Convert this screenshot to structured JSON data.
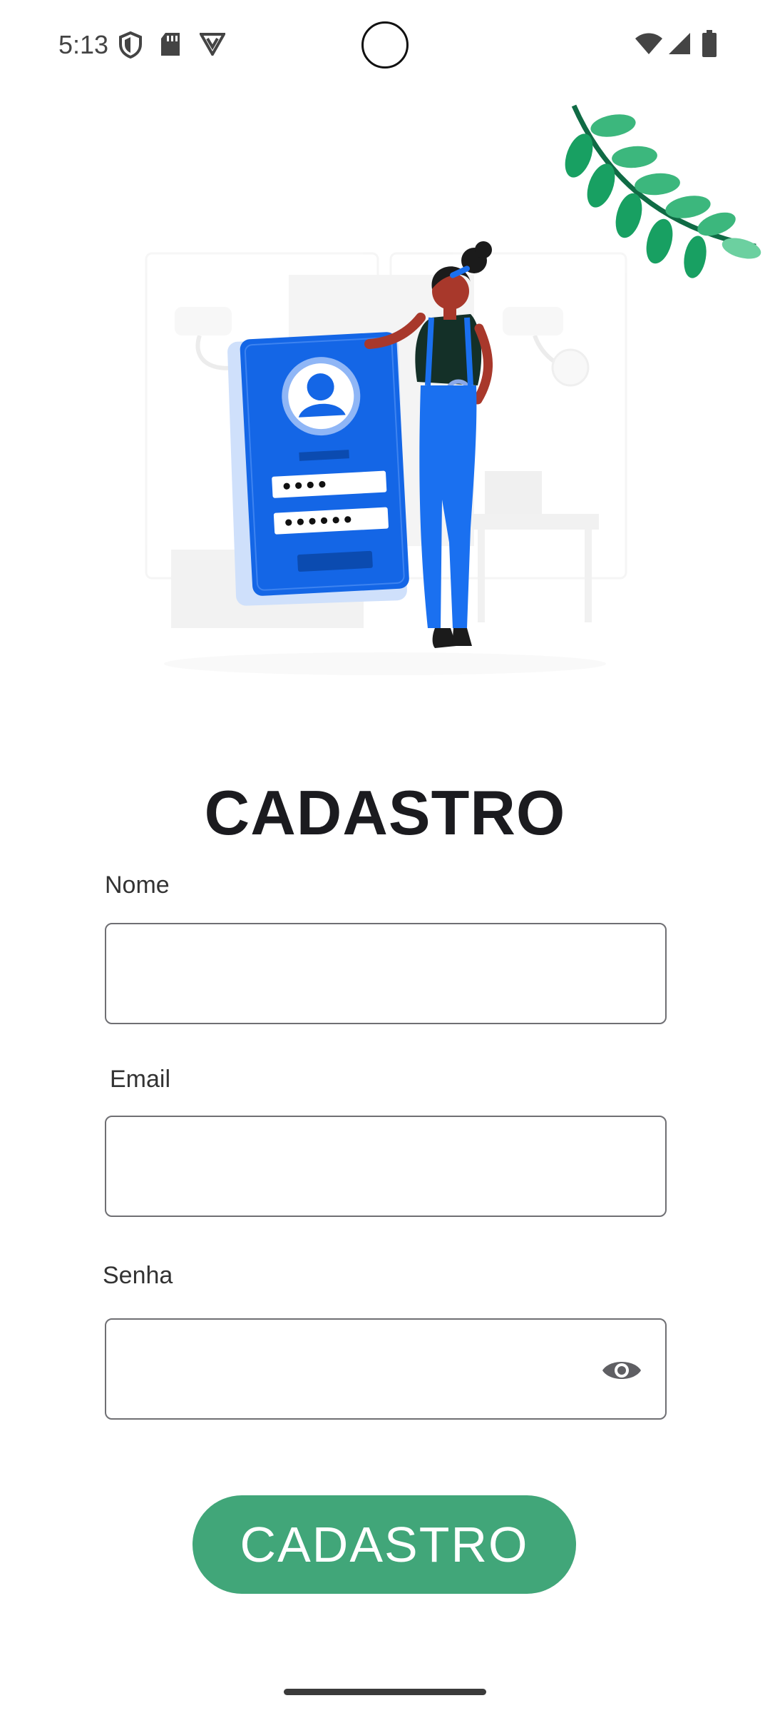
{
  "status_bar": {
    "time": "5:13",
    "left_icons": [
      "shield-icon",
      "sd-card-icon",
      "vpn-icon"
    ],
    "right_icons": [
      "wifi-icon",
      "signal-icon",
      "battery-icon"
    ]
  },
  "illustration": {
    "description_icon": "signup-illustration",
    "screen_fields": [
      "••••",
      "••••••"
    ]
  },
  "title": "CADASTRO",
  "form": {
    "name_label": "Nome",
    "name_value": "",
    "email_label": "Email",
    "email_value": "",
    "password_label": "Senha",
    "password_value": "",
    "password_toggle_icon": "eye-icon"
  },
  "submit_label": "CADASTRO",
  "colors": {
    "accent": "#41a679",
    "phone_blue": "#1466e6",
    "leaf_green": "#1f9e6a"
  }
}
